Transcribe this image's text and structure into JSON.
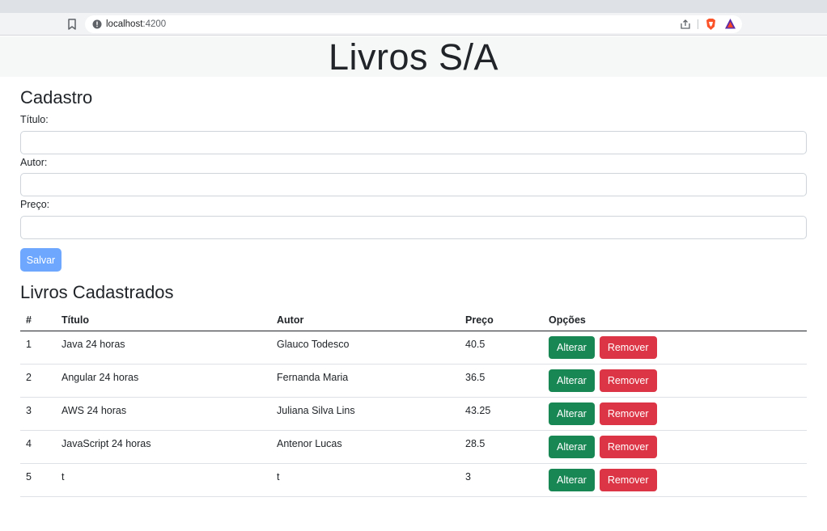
{
  "browser": {
    "url_host": "localhost",
    "url_port": ":4200",
    "icons": [
      "bookmark-icon",
      "info-icon",
      "share-icon",
      "brave-shields-icon",
      "brave-rewards-icon"
    ]
  },
  "header": {
    "title": "Livros S/A"
  },
  "form": {
    "heading": "Cadastro",
    "titulo_label": "Título:",
    "titulo_value": "",
    "autor_label": "Autor:",
    "autor_value": "",
    "preco_label": "Preço:",
    "preco_value": "",
    "save_label": "Salvar"
  },
  "list": {
    "heading": "Livros Cadastrados",
    "columns": [
      "#",
      "Título",
      "Autor",
      "Preço",
      "Opções"
    ],
    "edit_label": "Alterar",
    "remove_label": "Remover",
    "rows": [
      {
        "num": "1",
        "titulo": "Java 24 horas",
        "autor": "Glauco Todesco",
        "preco": "40.5"
      },
      {
        "num": "2",
        "titulo": "Angular 24 horas",
        "autor": "Fernanda Maria",
        "preco": "36.5"
      },
      {
        "num": "3",
        "titulo": "AWS 24 horas",
        "autor": "Juliana Silva Lins",
        "preco": "43.25"
      },
      {
        "num": "4",
        "titulo": "JavaScript 24 horas",
        "autor": "Antenor Lucas",
        "preco": "28.5"
      },
      {
        "num": "5",
        "titulo": "t",
        "autor": "t",
        "preco": "3"
      }
    ]
  },
  "colors": {
    "save_button": "#6ea8fe",
    "alterar_button": "#198754",
    "remover_button": "#dc3545",
    "header_bg": "#f6f8f7"
  }
}
